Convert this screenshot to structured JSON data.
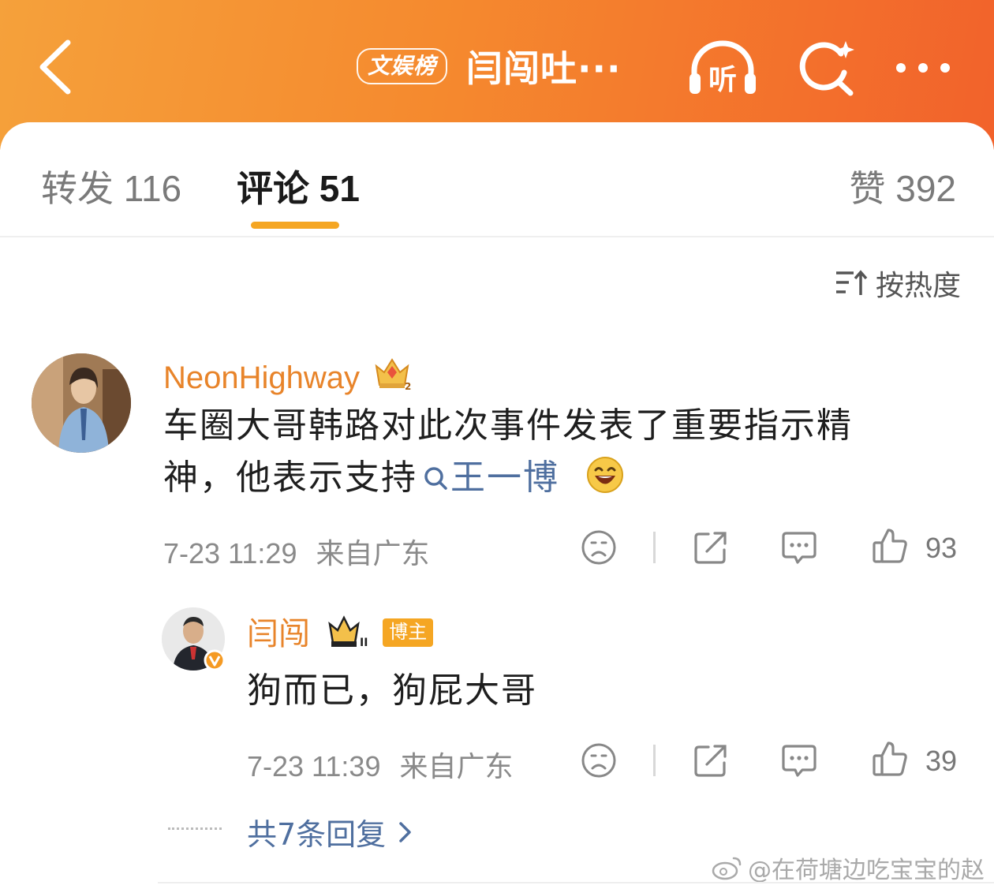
{
  "header": {
    "back_icon": "chevron-left-icon",
    "tag": "文娱榜",
    "title": "闫闯吐···",
    "listen_label": "听",
    "icons": [
      "headphones-icon",
      "search-sparkle-icon",
      "more-icon"
    ],
    "gradient": [
      "#f5a13b",
      "#f2622b"
    ]
  },
  "tabs": {
    "repost": "转发 116",
    "comment": "评论 51",
    "like": "赞 392",
    "active": "comment",
    "accent": "#f5a623"
  },
  "sort": {
    "label": "按热度",
    "icon": "sort-icon"
  },
  "comment": {
    "username": "NeonHighway",
    "badge_icon": "crown-level-2-icon",
    "text_part1": "车圈大哥韩路对此次事件发表了重要指示精神，他表示支持",
    "topic": "王一博",
    "emoji": "laughing-emoji-icon",
    "time": "7-23 11:29",
    "location": "来自广东",
    "likes": "93"
  },
  "reply": {
    "username": "闫闯",
    "badge_icon": "crown-level-2-icon",
    "role": "博主",
    "verified_icon": "verified-v-icon",
    "text": "狗而已，狗屁大哥",
    "time": "7-23 11:39",
    "location": "来自广东",
    "likes": "39"
  },
  "replies_more": {
    "label": "共7条回复"
  },
  "watermark": "@在荷塘边吃宝宝的赵"
}
